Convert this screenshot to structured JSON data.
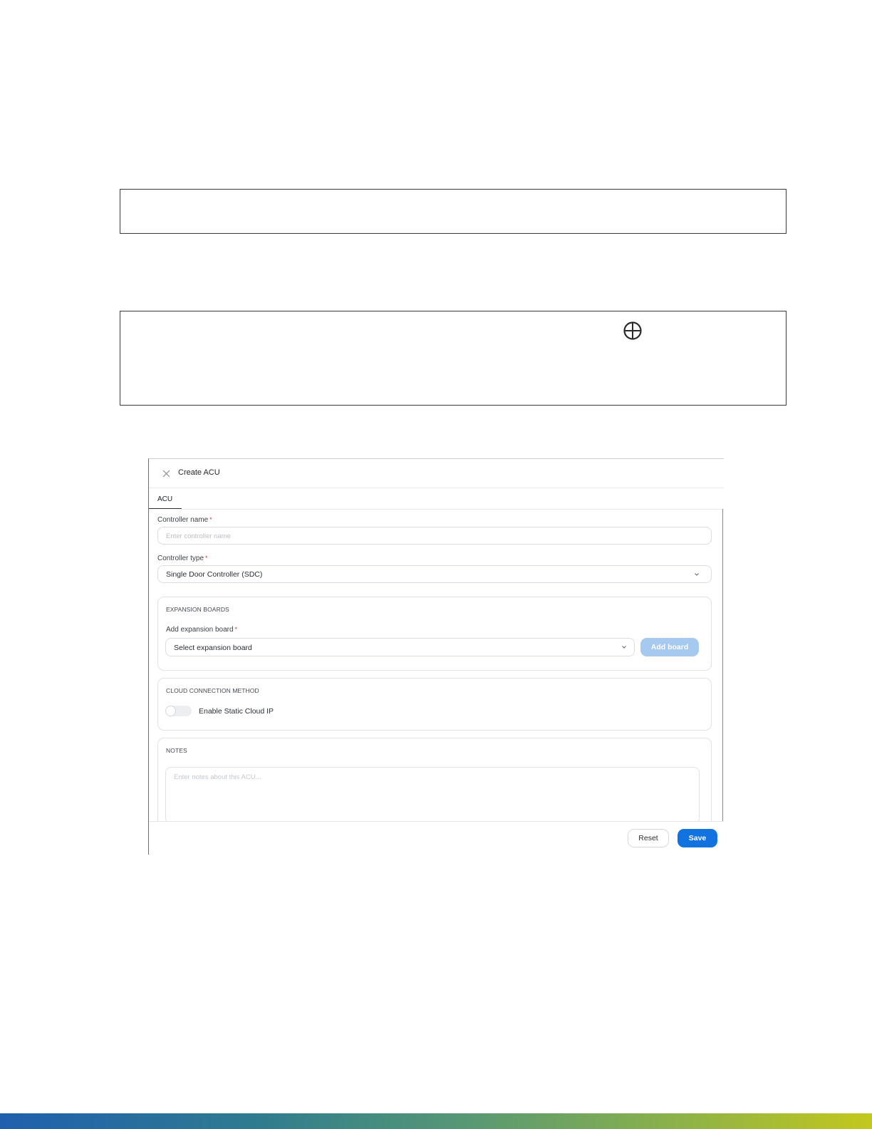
{
  "dialog": {
    "title": "Create ACU",
    "tab_label": "ACU",
    "controller_name": {
      "label": "Controller name",
      "required_mark": "*",
      "placeholder": "Enter controller name",
      "value": ""
    },
    "controller_type": {
      "label": "Controller type",
      "required_mark": "*",
      "selected": "Single Door Controller (SDC)"
    },
    "expansion_boards": {
      "section_title": "EXPANSION BOARDS",
      "field_label": "Add expansion board",
      "required_mark": "*",
      "selected": "Select expansion board",
      "add_button_label": "Add board"
    },
    "cloud_connection": {
      "section_title": "CLOUD CONNECTION METHOD",
      "toggle_label": "Enable Static Cloud IP",
      "toggle_on": false
    },
    "notes": {
      "section_title": "NOTES",
      "placeholder": "Enter notes about this ACU..."
    },
    "footer": {
      "reset_label": "Reset",
      "save_label": "Save"
    }
  },
  "colors": {
    "primary": "#1173e0",
    "primary_disabled": "#a6c9ef",
    "required": "#d13b3b"
  },
  "icons": {
    "doc_icon": "globe-icon",
    "close": "close-icon",
    "dropdown": "chevron-down-icon"
  }
}
